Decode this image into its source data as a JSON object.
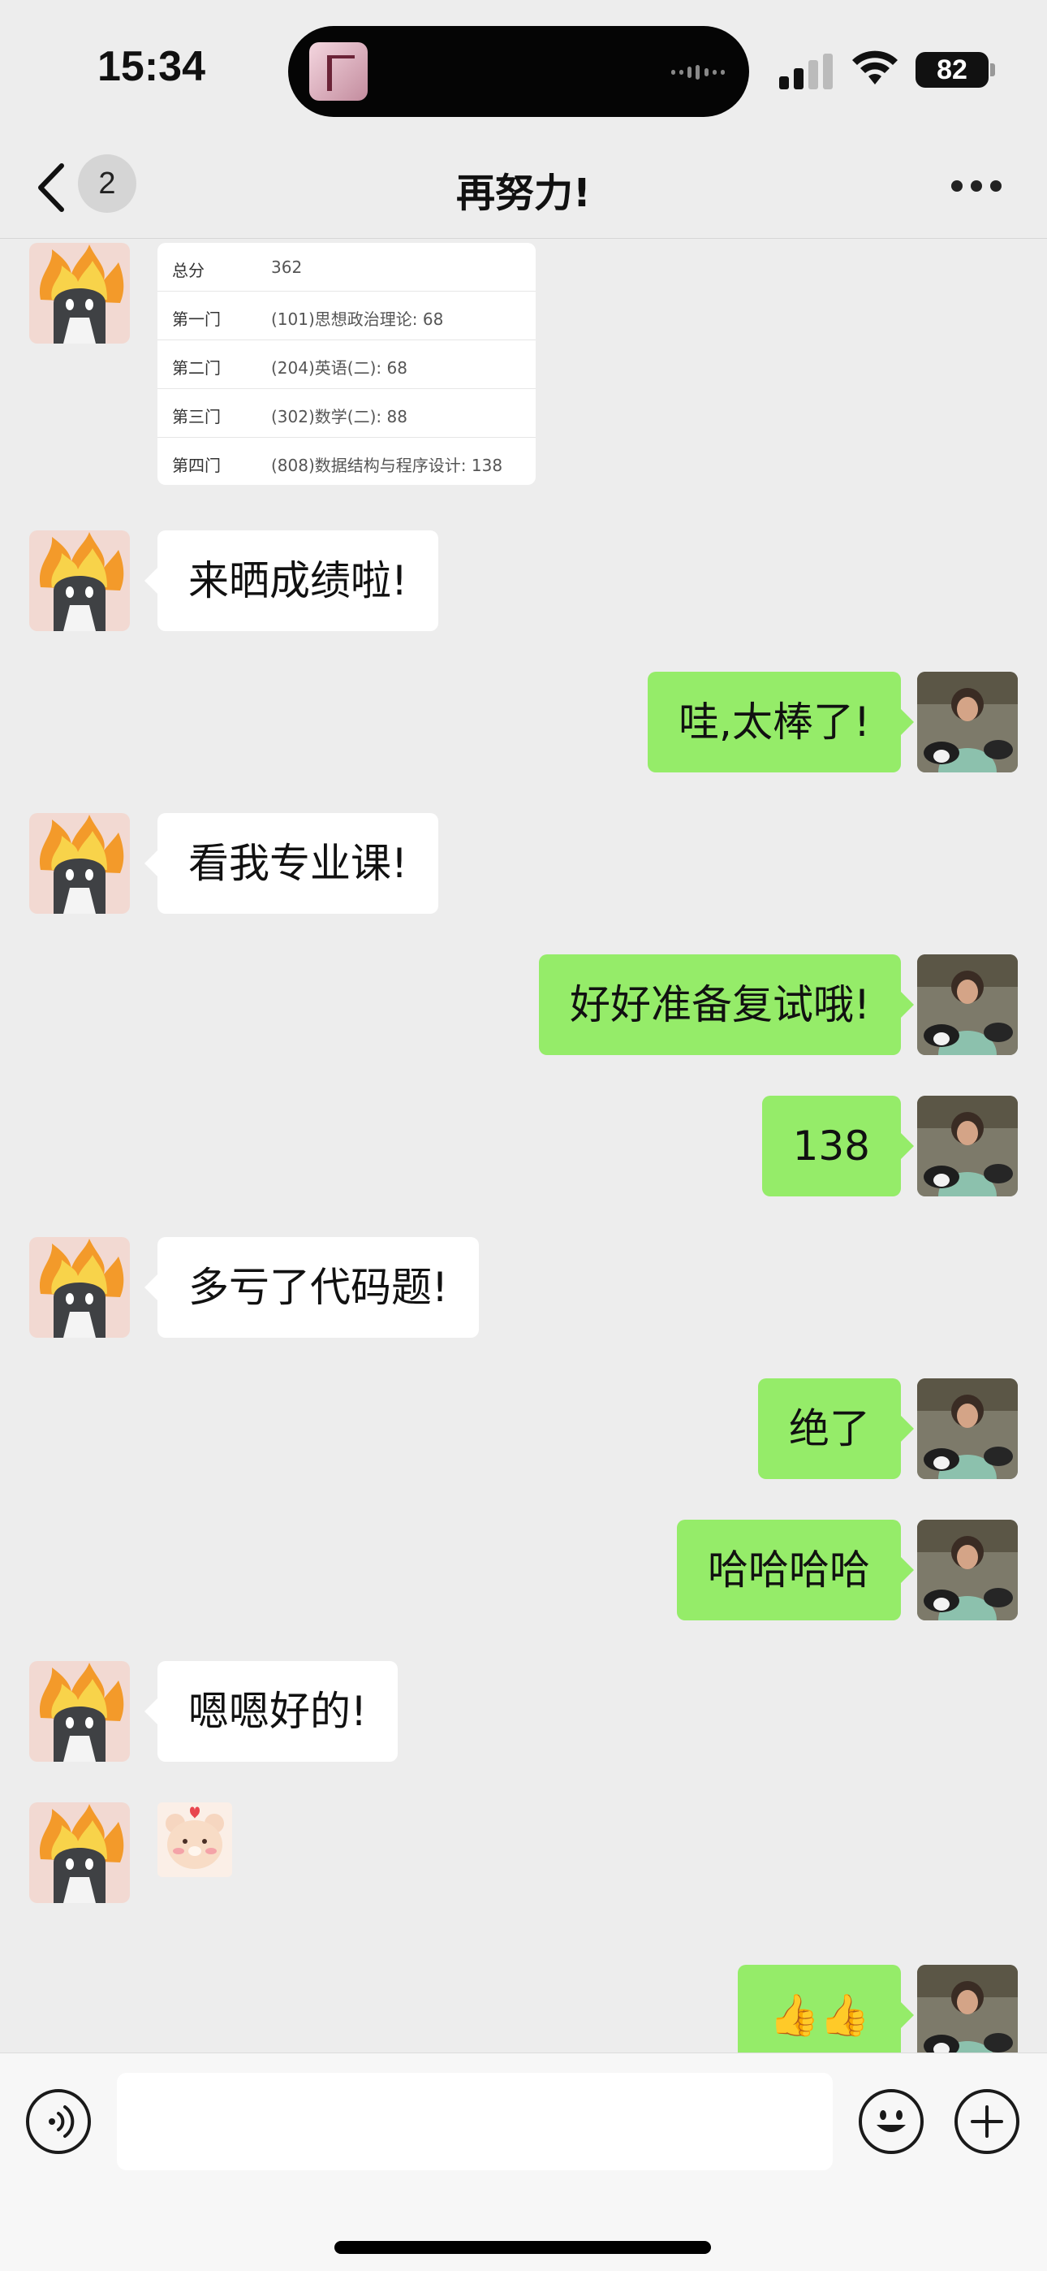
{
  "status": {
    "time": "15:34",
    "battery": "82"
  },
  "nav": {
    "unread_badge": "2",
    "title": "再努力!"
  },
  "score_card": {
    "rows": [
      {
        "label": "总分",
        "value": "362"
      },
      {
        "label": "第一门",
        "value": "(101)思想政治理论: 68"
      },
      {
        "label": "第二门",
        "value": "(204)英语(二): 68"
      },
      {
        "label": "第三门",
        "value": "(302)数学(二): 88"
      },
      {
        "label": "第四门",
        "value": "(808)数据结构与程序设计: 138"
      }
    ]
  },
  "messages": [
    {
      "side": "in",
      "text": "来晒成绩啦!"
    },
    {
      "side": "out",
      "text": "哇,太棒了!"
    },
    {
      "side": "in",
      "text": "看我专业课!"
    },
    {
      "side": "out",
      "text": "好好准备复试哦!"
    },
    {
      "side": "out",
      "text": "138"
    },
    {
      "side": "in",
      "text": "多亏了代码题!"
    },
    {
      "side": "out",
      "text": "绝了"
    },
    {
      "side": "out",
      "text": "哈哈哈哈"
    },
    {
      "side": "in",
      "text": "嗯嗯好的!"
    },
    {
      "side": "in",
      "text": "bear-sticker"
    },
    {
      "side": "out",
      "text": "👍👍"
    }
  ],
  "input": {
    "value": ""
  },
  "colors": {
    "background": "#ededed",
    "outgoing_bubble": "#95ec69",
    "incoming_bubble": "#ffffff"
  },
  "icons": [
    "back-chevron-icon",
    "more-dots-icon",
    "voice-icon",
    "emoji-icon",
    "plus-icon",
    "signal-icon",
    "wifi-icon",
    "battery-icon"
  ]
}
